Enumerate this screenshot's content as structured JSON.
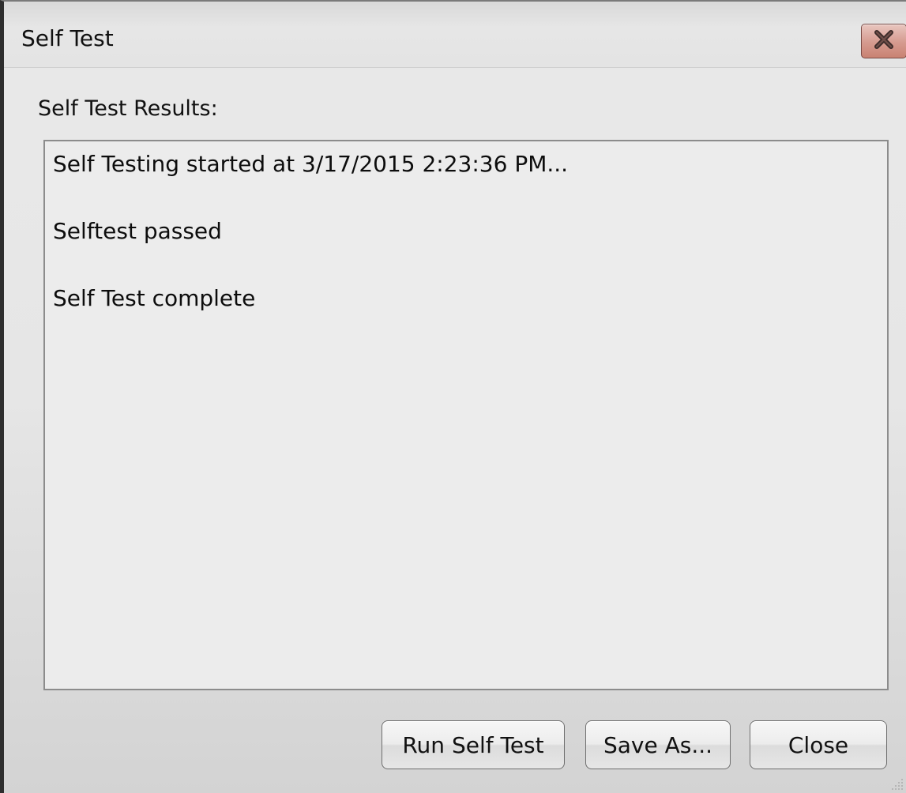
{
  "window": {
    "title": "Self Test"
  },
  "title_bar": {
    "close_icon": "close-x-icon",
    "close_color": "#d38d80"
  },
  "results": {
    "label": "Self Test Results:",
    "lines": [
      "Self Testing started at 3/17/2015 2:23:36 PM...",
      "Selftest passed",
      "Self Test complete"
    ]
  },
  "buttons": {
    "run_self_test": "Run Self Test",
    "save_as": "Save As...",
    "close": "Close"
  },
  "resize_grip_icon": "resize-grip-icon"
}
